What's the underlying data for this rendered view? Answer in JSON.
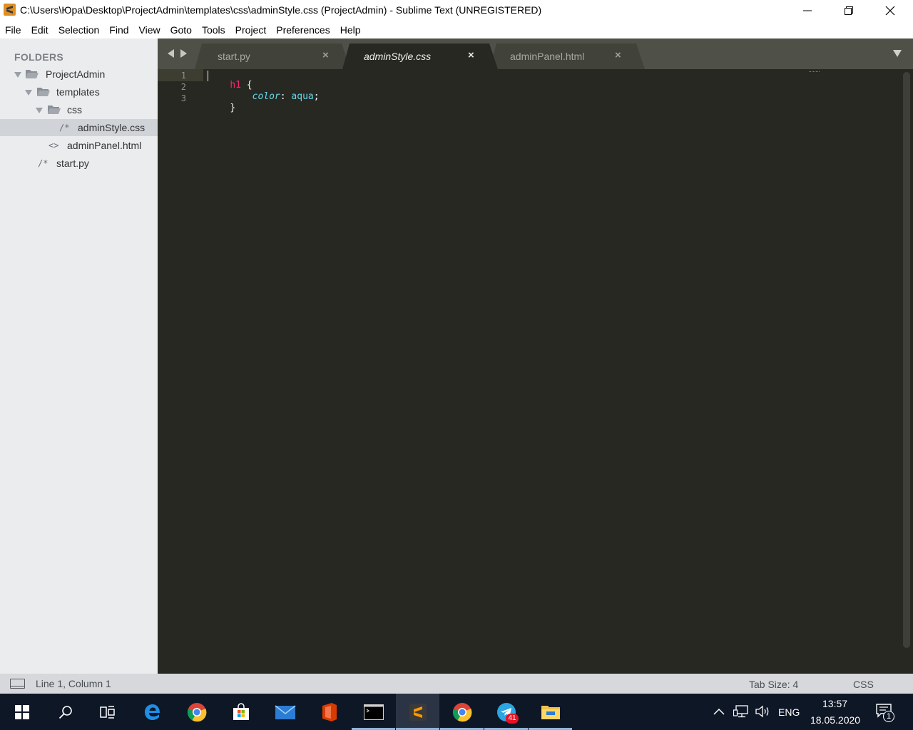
{
  "window": {
    "title": "C:\\Users\\Юра\\Desktop\\ProjectAdmin\\templates\\css\\adminStyle.css (ProjectAdmin) - Sublime Text (UNREGISTERED)",
    "icon": "sublime-text-icon"
  },
  "menu": [
    "File",
    "Edit",
    "Selection",
    "Find",
    "View",
    "Goto",
    "Tools",
    "Project",
    "Preferences",
    "Help"
  ],
  "sidebar": {
    "heading": "FOLDERS",
    "tree": [
      {
        "label": "ProjectAdmin",
        "kind": "folder",
        "expanded": true
      },
      {
        "label": "templates",
        "kind": "folder",
        "expanded": true
      },
      {
        "label": "css",
        "kind": "folder",
        "expanded": true
      },
      {
        "label": "adminStyle.css",
        "kind": "file",
        "marker": "/*",
        "selected": true
      },
      {
        "label": "adminPanel.html",
        "kind": "file",
        "marker": "<>"
      },
      {
        "label": "start.py",
        "kind": "file",
        "marker": "/*"
      }
    ]
  },
  "tabs": [
    {
      "label": "start.py",
      "active": false
    },
    {
      "label": "adminStyle.css",
      "active": true
    },
    {
      "label": "adminPanel.html",
      "active": false
    }
  ],
  "tab_close_glyph": "×",
  "editor": {
    "line_numbers": [
      "1",
      "2",
      "3"
    ],
    "lines": [
      [
        {
          "t": "h1",
          "c": "sel"
        },
        {
          "t": " {",
          "c": "punc"
        }
      ],
      [
        {
          "t": "    ",
          "c": "punc"
        },
        {
          "t": "color",
          "c": "prop"
        },
        {
          "t": ": ",
          "c": "punc"
        },
        {
          "t": "aqua",
          "c": "val"
        },
        {
          "t": ";",
          "c": "punc"
        }
      ],
      [
        {
          "t": "}",
          "c": "punc"
        }
      ]
    ]
  },
  "status": {
    "position": "Line 1, Column 1",
    "tab_size": "Tab Size: 4",
    "syntax": "CSS"
  },
  "taskbar": {
    "telegram_badge": "41",
    "language": "ENG",
    "time": "13:57",
    "date": "18.05.2020",
    "notifications": "1"
  },
  "colors": {
    "editor_bg": "#272822",
    "tabbar_bg": "#4f5047",
    "sidebar_bg": "#eaecee",
    "selector": "#f92672",
    "property": "#66d9ef",
    "taskbar_bg": "#0e1726"
  }
}
